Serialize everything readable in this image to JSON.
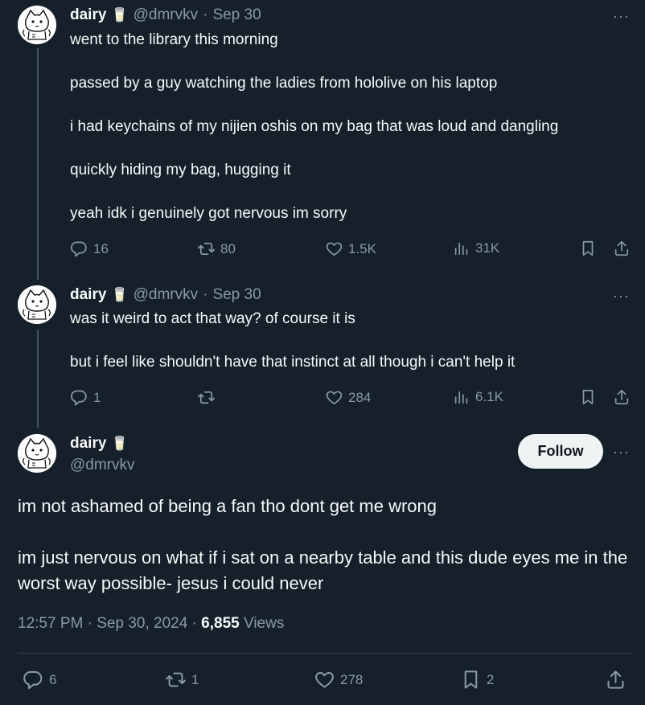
{
  "tweet1": {
    "name": "dairy",
    "name_emoji": "🥛",
    "handle": "@dmrvkv",
    "separator": "·",
    "date": "Sep 30",
    "paragraphs": [
      "went to the library this morning",
      "passed by a guy watching the ladies from hololive on his laptop",
      "i had keychains of my nijien oshis on my bag that was loud and dangling",
      "quickly hiding my bag, hugging it",
      "yeah idk i genuinely got nervous im sorry"
    ],
    "replies": "16",
    "retweets": "80",
    "likes": "1.5K",
    "views": "31K",
    "more": "···"
  },
  "tweet2": {
    "name": "dairy",
    "name_emoji": "🥛",
    "handle": "@dmrvkv",
    "separator": "·",
    "date": "Sep 30",
    "paragraphs": [
      "was it weird to act that way? of course it is",
      "but i feel like shouldn't have that instinct at all though i can't help it"
    ],
    "replies": "1",
    "retweets": "",
    "likes": "284",
    "views": "6.1K",
    "more": "···"
  },
  "main": {
    "name": "dairy",
    "name_emoji": "🥛",
    "handle": "@dmrvkv",
    "follow_label": "Follow",
    "more": "···",
    "paragraphs": [
      "im not ashamed of being a fan tho dont get me wrong",
      "im just nervous on what if i sat on a nearby table and this dude eyes me in the worst way possible- jesus i could never"
    ],
    "time": "12:57 PM",
    "sep": "·",
    "date": "Sep 30, 2024",
    "views_count": "6,855",
    "views_label": "Views",
    "replies": "6",
    "retweets": "1",
    "likes": "278",
    "bookmarks": "2"
  },
  "icons": {
    "reply": "reply-icon",
    "retweet": "retweet-icon",
    "like": "heart-icon",
    "views": "views-chart-icon",
    "bookmark": "bookmark-icon",
    "share": "share-icon"
  },
  "colors": {
    "background": "#15202b",
    "text": "#f7f9f9",
    "muted": "#8b98a5",
    "follow_bg": "#eff3f4"
  }
}
